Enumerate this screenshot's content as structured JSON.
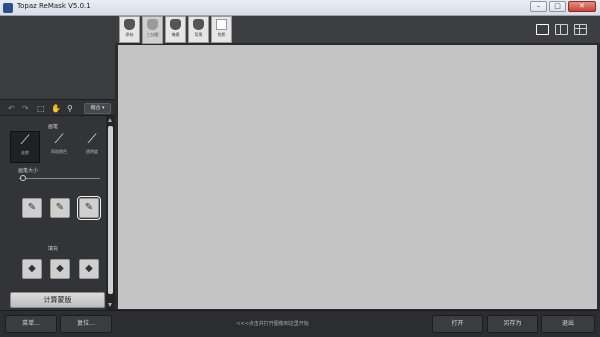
{
  "window": {
    "title": "Topaz ReMask V5.0.1",
    "minimize": "–",
    "maximize": "□",
    "close": "✕"
  },
  "tabs": [
    {
      "label": "原始"
    },
    {
      "label": "三分图"
    },
    {
      "label": "掩模"
    },
    {
      "label": "背景"
    },
    {
      "label": "剪影"
    }
  ],
  "toolbar": {
    "mode_label": "缩合"
  },
  "brush": {
    "section_title": "画笔",
    "types": [
      {
        "label": "去除",
        "icon": "brush-icon"
      },
      {
        "label": "再现颜色",
        "icon": "magic-brush-icon"
      },
      {
        "label": "透明度",
        "icon": "fill-brush-icon"
      }
    ],
    "size_label": "画笔大小",
    "size_value_fraction": 0.05
  },
  "fill": {
    "section_title": "填充"
  },
  "compute_button": "计算蒙版",
  "bottom": {
    "menu": "菜单...",
    "reset": "复位...",
    "hint": "<<<点击并打开图像到这里开始",
    "open": "打开",
    "save_as": "另存为",
    "exit": "退出"
  }
}
